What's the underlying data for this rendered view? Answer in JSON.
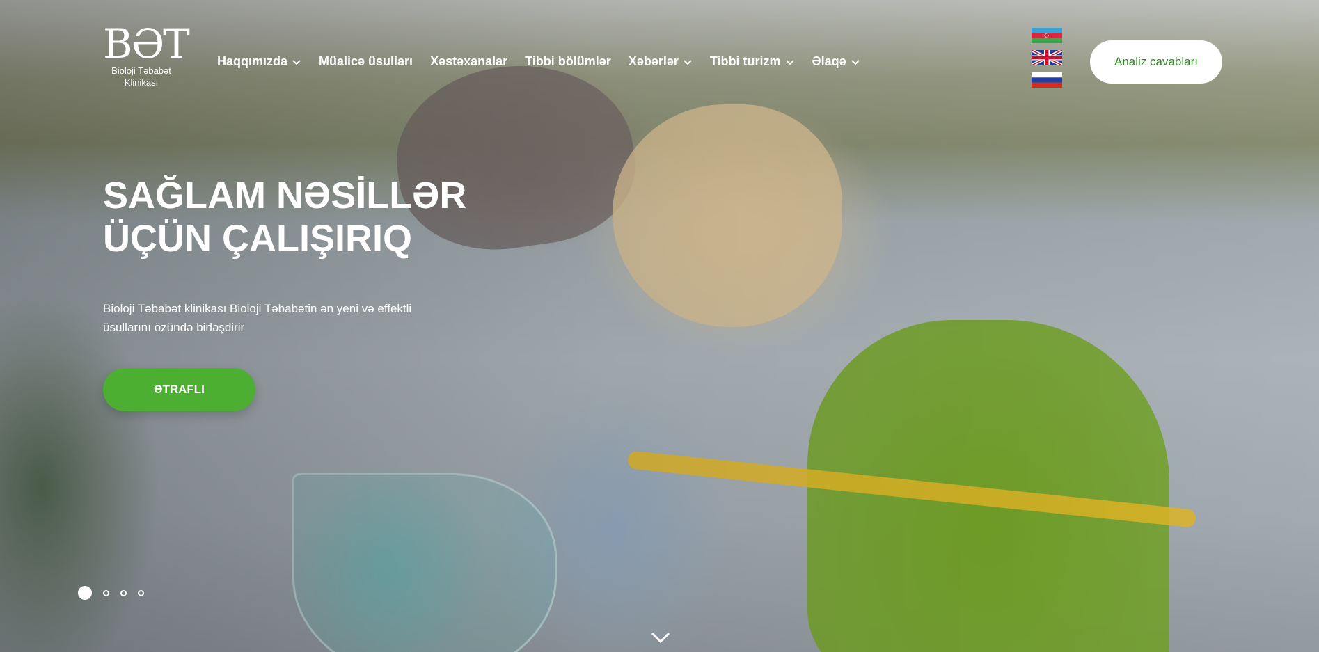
{
  "header": {
    "logo": {
      "mark": "BƏT",
      "line1": "Bioloji Təbabət",
      "line2": "Klinikası"
    },
    "nav": [
      {
        "label": "Haqqımızda",
        "has_dropdown": true
      },
      {
        "label": "Müalicə üsulları",
        "has_dropdown": false
      },
      {
        "label": "Xəstəxanalar",
        "has_dropdown": false
      },
      {
        "label": "Tibbi bölümlər",
        "has_dropdown": false
      },
      {
        "label": "Xəbərlər",
        "has_dropdown": true
      },
      {
        "label": "Tibbi turizm",
        "has_dropdown": true
      },
      {
        "label": "Əlaqə",
        "has_dropdown": true
      }
    ],
    "languages": [
      "azerbaijan-flag-icon",
      "uk-flag-icon",
      "russia-flag-icon"
    ],
    "cta_label": "Analiz cavabları"
  },
  "hero": {
    "title_line1": "SAĞLAM NƏSİLLƏR",
    "title_line2": "ÜÇÜN ÇALIŞIRIQ",
    "subtitle_line1": "Bioloji Təbabət klinikası Bioloji Təbabətin ən yeni və effektli",
    "subtitle_line2": "üsullarını özündə birləşdirir",
    "button_label": "ƏTRAFLI"
  },
  "slider": {
    "slide_count": 4,
    "active_index": 0
  },
  "colors": {
    "accent_green": "#4caf32",
    "cta_text_green": "#2c8a1f",
    "text_white": "#ffffff"
  }
}
